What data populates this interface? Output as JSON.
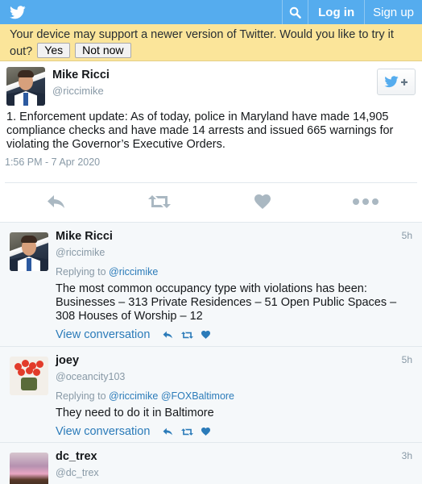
{
  "topbar": {
    "login_label": "Log in",
    "signup_label": "Sign up"
  },
  "banner": {
    "message": "Your device may support a newer version of Twitter. Would you like to try it out?",
    "yes_label": "Yes",
    "no_label": "Not now"
  },
  "main_tweet": {
    "name": "Mike Ricci",
    "handle": "@riccimike",
    "text": "1. Enforcement update: As of today, police in Maryland have made 14,905 compliance checks and have made 14 arrests and issued 665 warnings for violating the Governor’s Executive Orders.",
    "timestamp": "1:56 PM - 7 Apr 2020"
  },
  "replies": [
    {
      "name": "Mike Ricci",
      "handle": "@riccimike",
      "time": "5h",
      "replying_prefix": "Replying to",
      "replying_to": [
        "@riccimike"
      ],
      "text": "The most common occupancy type with violations has been: Businesses – 313 Private Residences – 51 Open Public Spaces – 308 Houses of Worship – 12",
      "view_conversation": "View conversation"
    },
    {
      "name": "joey",
      "handle": "@oceancity103",
      "time": "5h",
      "replying_prefix": "Replying to",
      "replying_to": [
        "@riccimike",
        "@FOXBaltimore"
      ],
      "text": "They need to do it in Baltimore",
      "view_conversation": "View conversation"
    },
    {
      "name": "dc_trex",
      "handle": "@dc_trex",
      "time": "3h"
    }
  ],
  "colors": {
    "brand": "#55acee",
    "link": "#2b7bb9",
    "muted": "#8899a6",
    "banner": "#fbe59a"
  }
}
